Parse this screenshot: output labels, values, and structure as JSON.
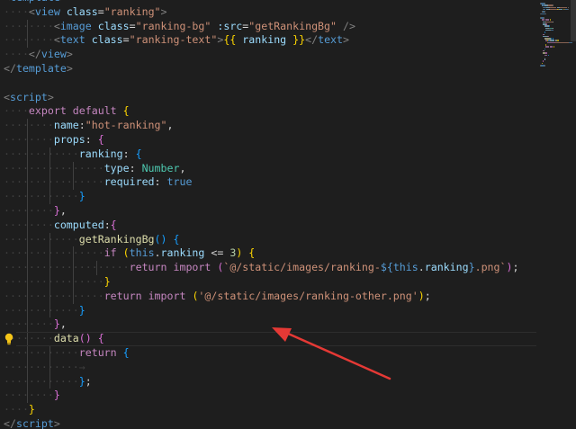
{
  "colors": {
    "background": "#1e1e1e",
    "guide": "#404040",
    "annotation_arrow": "#e53935",
    "bulb": "#f5c518"
  },
  "icons": {
    "gutter": "lightbulb-icon",
    "annotation": "red-arrow"
  },
  "lines": [
    {
      "indent": 0,
      "tokens": [
        {
          "c": "tk-bracket",
          "t": "<"
        },
        {
          "c": "tk-tag",
          "t": "template"
        },
        {
          "c": "tk-bracket",
          "t": ">"
        }
      ]
    },
    {
      "indent": 1,
      "tokens": [
        {
          "c": "tk-bracket",
          "t": "<"
        },
        {
          "c": "tk-tag",
          "t": "view"
        },
        {
          "c": "tk-txt",
          "t": " "
        },
        {
          "c": "tk-attr",
          "t": "class"
        },
        {
          "c": "tk-pun",
          "t": "="
        },
        {
          "c": "tk-str",
          "t": "\"ranking\""
        },
        {
          "c": "tk-bracket",
          "t": ">"
        }
      ]
    },
    {
      "indent": 2,
      "tokens": [
        {
          "c": "tk-bracket",
          "t": "<"
        },
        {
          "c": "tk-tag",
          "t": "image"
        },
        {
          "c": "tk-txt",
          "t": " "
        },
        {
          "c": "tk-attr",
          "t": "class"
        },
        {
          "c": "tk-pun",
          "t": "="
        },
        {
          "c": "tk-str",
          "t": "\"ranking-bg\""
        },
        {
          "c": "tk-txt",
          "t": " "
        },
        {
          "c": "tk-attr",
          "t": ":src"
        },
        {
          "c": "tk-pun",
          "t": "="
        },
        {
          "c": "tk-str",
          "t": "\"getRankingBg\""
        },
        {
          "c": "tk-txt",
          "t": " "
        },
        {
          "c": "tk-bracket",
          "t": "/>"
        }
      ]
    },
    {
      "indent": 2,
      "tokens": [
        {
          "c": "tk-bracket",
          "t": "<"
        },
        {
          "c": "tk-tag",
          "t": "text"
        },
        {
          "c": "tk-txt",
          "t": " "
        },
        {
          "c": "tk-attr",
          "t": "class"
        },
        {
          "c": "tk-pun",
          "t": "="
        },
        {
          "c": "tk-str",
          "t": "\"ranking-text\""
        },
        {
          "c": "tk-bracket",
          "t": ">"
        },
        {
          "c": "tk-b1",
          "t": "{{"
        },
        {
          "c": "tk-txt",
          "t": " "
        },
        {
          "c": "tk-prop",
          "t": "ranking"
        },
        {
          "c": "tk-txt",
          "t": " "
        },
        {
          "c": "tk-b1",
          "t": "}}"
        },
        {
          "c": "tk-bracket",
          "t": "</"
        },
        {
          "c": "tk-tag",
          "t": "text"
        },
        {
          "c": "tk-bracket",
          "t": ">"
        }
      ]
    },
    {
      "indent": 1,
      "tokens": [
        {
          "c": "tk-bracket",
          "t": "</"
        },
        {
          "c": "tk-tag",
          "t": "view"
        },
        {
          "c": "tk-bracket",
          "t": ">"
        }
      ]
    },
    {
      "indent": 0,
      "tokens": [
        {
          "c": "tk-bracket",
          "t": "</"
        },
        {
          "c": "tk-tag",
          "t": "template"
        },
        {
          "c": "tk-bracket",
          "t": ">"
        }
      ]
    },
    {
      "indent": 0,
      "tokens": []
    },
    {
      "indent": 0,
      "tokens": [
        {
          "c": "tk-bracket",
          "t": "<"
        },
        {
          "c": "tk-tag",
          "t": "script"
        },
        {
          "c": "tk-bracket",
          "t": ">"
        }
      ]
    },
    {
      "indent": 1,
      "tokens": [
        {
          "c": "tk-kwc",
          "t": "export"
        },
        {
          "c": "tk-txt",
          "t": " "
        },
        {
          "c": "tk-kwc",
          "t": "default"
        },
        {
          "c": "tk-txt",
          "t": " "
        },
        {
          "c": "tk-b1",
          "t": "{"
        }
      ]
    },
    {
      "indent": 2,
      "tokens": [
        {
          "c": "tk-prop",
          "t": "name"
        },
        {
          "c": "tk-pun",
          "t": ":"
        },
        {
          "c": "tk-str",
          "t": "\"hot-ranking\""
        },
        {
          "c": "tk-pun",
          "t": ","
        }
      ]
    },
    {
      "indent": 2,
      "tokens": [
        {
          "c": "tk-prop",
          "t": "props"
        },
        {
          "c": "tk-pun",
          "t": ":"
        },
        {
          "c": "tk-txt",
          "t": " "
        },
        {
          "c": "tk-b2",
          "t": "{"
        }
      ]
    },
    {
      "indent": 3,
      "tokens": [
        {
          "c": "tk-prop",
          "t": "ranking"
        },
        {
          "c": "tk-pun",
          "t": ":"
        },
        {
          "c": "tk-txt",
          "t": " "
        },
        {
          "c": "tk-b3",
          "t": "{"
        }
      ]
    },
    {
      "indent": 4,
      "tokens": [
        {
          "c": "tk-prop",
          "t": "type"
        },
        {
          "c": "tk-pun",
          "t": ":"
        },
        {
          "c": "tk-txt",
          "t": " "
        },
        {
          "c": "tk-type",
          "t": "Number"
        },
        {
          "c": "tk-pun",
          "t": ","
        }
      ]
    },
    {
      "indent": 4,
      "tokens": [
        {
          "c": "tk-prop",
          "t": "required"
        },
        {
          "c": "tk-pun",
          "t": ":"
        },
        {
          "c": "tk-txt",
          "t": " "
        },
        {
          "c": "tk-kw",
          "t": "true"
        }
      ]
    },
    {
      "indent": 3,
      "tokens": [
        {
          "c": "tk-b3",
          "t": "}"
        }
      ]
    },
    {
      "indent": 2,
      "tokens": [
        {
          "c": "tk-b2",
          "t": "}"
        },
        {
          "c": "tk-pun",
          "t": ","
        }
      ]
    },
    {
      "indent": 2,
      "tokens": [
        {
          "c": "tk-prop",
          "t": "computed"
        },
        {
          "c": "tk-pun",
          "t": ":"
        },
        {
          "c": "tk-b2",
          "t": "{"
        }
      ]
    },
    {
      "indent": 3,
      "tokens": [
        {
          "c": "tk-fn",
          "t": "getRankingBg"
        },
        {
          "c": "tk-b3",
          "t": "()"
        },
        {
          "c": "tk-txt",
          "t": " "
        },
        {
          "c": "tk-b3",
          "t": "{"
        }
      ]
    },
    {
      "indent": 4,
      "tokens": [
        {
          "c": "tk-kwc",
          "t": "if"
        },
        {
          "c": "tk-txt",
          "t": " "
        },
        {
          "c": "tk-b1",
          "t": "("
        },
        {
          "c": "tk-kw",
          "t": "this"
        },
        {
          "c": "tk-pun",
          "t": "."
        },
        {
          "c": "tk-prop",
          "t": "ranking"
        },
        {
          "c": "tk-txt",
          "t": " "
        },
        {
          "c": "tk-pun",
          "t": "<="
        },
        {
          "c": "tk-txt",
          "t": " "
        },
        {
          "c": "tk-num",
          "t": "3"
        },
        {
          "c": "tk-b1",
          "t": ")"
        },
        {
          "c": "tk-txt",
          "t": " "
        },
        {
          "c": "tk-b1",
          "t": "{"
        }
      ]
    },
    {
      "indent": 5,
      "tokens": [
        {
          "c": "tk-kwc",
          "t": "return"
        },
        {
          "c": "tk-txt",
          "t": " "
        },
        {
          "c": "tk-kwc",
          "t": "import"
        },
        {
          "c": "tk-txt",
          "t": " "
        },
        {
          "c": "tk-b2",
          "t": "("
        },
        {
          "c": "tk-str",
          "t": "`@/static/images/ranking-"
        },
        {
          "c": "tk-kw",
          "t": "${"
        },
        {
          "c": "tk-kw",
          "t": "this"
        },
        {
          "c": "tk-pun",
          "t": "."
        },
        {
          "c": "tk-prop",
          "t": "ranking"
        },
        {
          "c": "tk-kw",
          "t": "}"
        },
        {
          "c": "tk-str",
          "t": ".png`"
        },
        {
          "c": "tk-b2",
          "t": ")"
        },
        {
          "c": "tk-pun",
          "t": ";"
        }
      ]
    },
    {
      "indent": 4,
      "tokens": [
        {
          "c": "tk-b1",
          "t": "}"
        }
      ]
    },
    {
      "indent": 4,
      "tokens": [
        {
          "c": "tk-kwc",
          "t": "return"
        },
        {
          "c": "tk-txt",
          "t": " "
        },
        {
          "c": "tk-kwc",
          "t": "import"
        },
        {
          "c": "tk-txt",
          "t": " "
        },
        {
          "c": "tk-b1",
          "t": "("
        },
        {
          "c": "tk-str",
          "t": "'@/static/images/ranking-other.png'"
        },
        {
          "c": "tk-b1",
          "t": ")"
        },
        {
          "c": "tk-pun",
          "t": ";"
        }
      ]
    },
    {
      "indent": 3,
      "tokens": [
        {
          "c": "tk-b3",
          "t": "}"
        }
      ]
    },
    {
      "indent": 2,
      "tokens": [
        {
          "c": "tk-b2",
          "t": "}"
        },
        {
          "c": "tk-pun",
          "t": ","
        }
      ]
    },
    {
      "indent": 2,
      "current": true,
      "bulb": true,
      "tokens": [
        {
          "c": "tk-fn",
          "t": "data"
        },
        {
          "c": "tk-b2",
          "t": "()"
        },
        {
          "c": "tk-txt",
          "t": " "
        },
        {
          "c": "tk-b2",
          "t": "{"
        }
      ]
    },
    {
      "indent": 3,
      "tokens": [
        {
          "c": "tk-kwc",
          "t": "return"
        },
        {
          "c": "tk-txt",
          "t": " "
        },
        {
          "c": "tk-b3",
          "t": "{"
        }
      ]
    },
    {
      "indent": 3,
      "tokens": [
        {
          "c": "tk-ws",
          "t": "→"
        }
      ]
    },
    {
      "indent": 3,
      "tokens": [
        {
          "c": "tk-b3",
          "t": "}"
        },
        {
          "c": "tk-pun",
          "t": ";"
        }
      ]
    },
    {
      "indent": 2,
      "tokens": [
        {
          "c": "tk-b2",
          "t": "}"
        }
      ]
    },
    {
      "indent": 1,
      "tokens": [
        {
          "c": "tk-b1",
          "t": "}"
        }
      ]
    },
    {
      "indent": 0,
      "tokens": [
        {
          "c": "tk-bracket",
          "t": "</"
        },
        {
          "c": "tk-tag",
          "t": "script"
        },
        {
          "c": "tk-bracket",
          "t": ">"
        }
      ]
    }
  ]
}
